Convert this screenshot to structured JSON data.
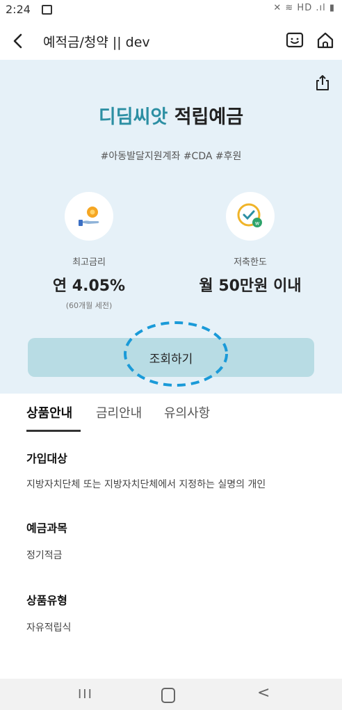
{
  "status": {
    "time": "2:24",
    "right": "✕ ≋ HD .ıl ▮"
  },
  "app_bar": {
    "title": "예적금/청약 || dev"
  },
  "product": {
    "title_accent": "디딤씨앗",
    "title_rest": "적립예금",
    "hashtags": "#아동발달지원계좌  #CDA  #후원"
  },
  "info": {
    "rate": {
      "label": "최고금리",
      "value": "연 4.05%",
      "note": "(60개월 세전)"
    },
    "limit": {
      "label": "저축한도",
      "value": "월 50만원 이내"
    }
  },
  "inquiry_button": "조회하기",
  "tabs": [
    {
      "label": "상품안내",
      "active": true
    },
    {
      "label": "금리안내",
      "active": false
    },
    {
      "label": "유의사항",
      "active": false
    }
  ],
  "sections": [
    {
      "heading": "가입대상",
      "text": "지방자치단체 또는 지방자치단체에서 지정하는 실명의 개인"
    },
    {
      "heading": "예금과목",
      "text": "정기적금"
    },
    {
      "heading": "상품유형",
      "text": "자유적립식"
    }
  ],
  "nav": {
    "recent": "III",
    "back": "<"
  },
  "colors": {
    "hero_bg": "#e6f1f8",
    "accent": "#2c8fa3",
    "button_bg": "#b8dce4",
    "highlight_dash": "#1a9ad8"
  },
  "icons": [
    "back-icon",
    "chatbot-icon",
    "home-icon",
    "share-icon",
    "coin-hand-icon",
    "clock-check-icon"
  ]
}
